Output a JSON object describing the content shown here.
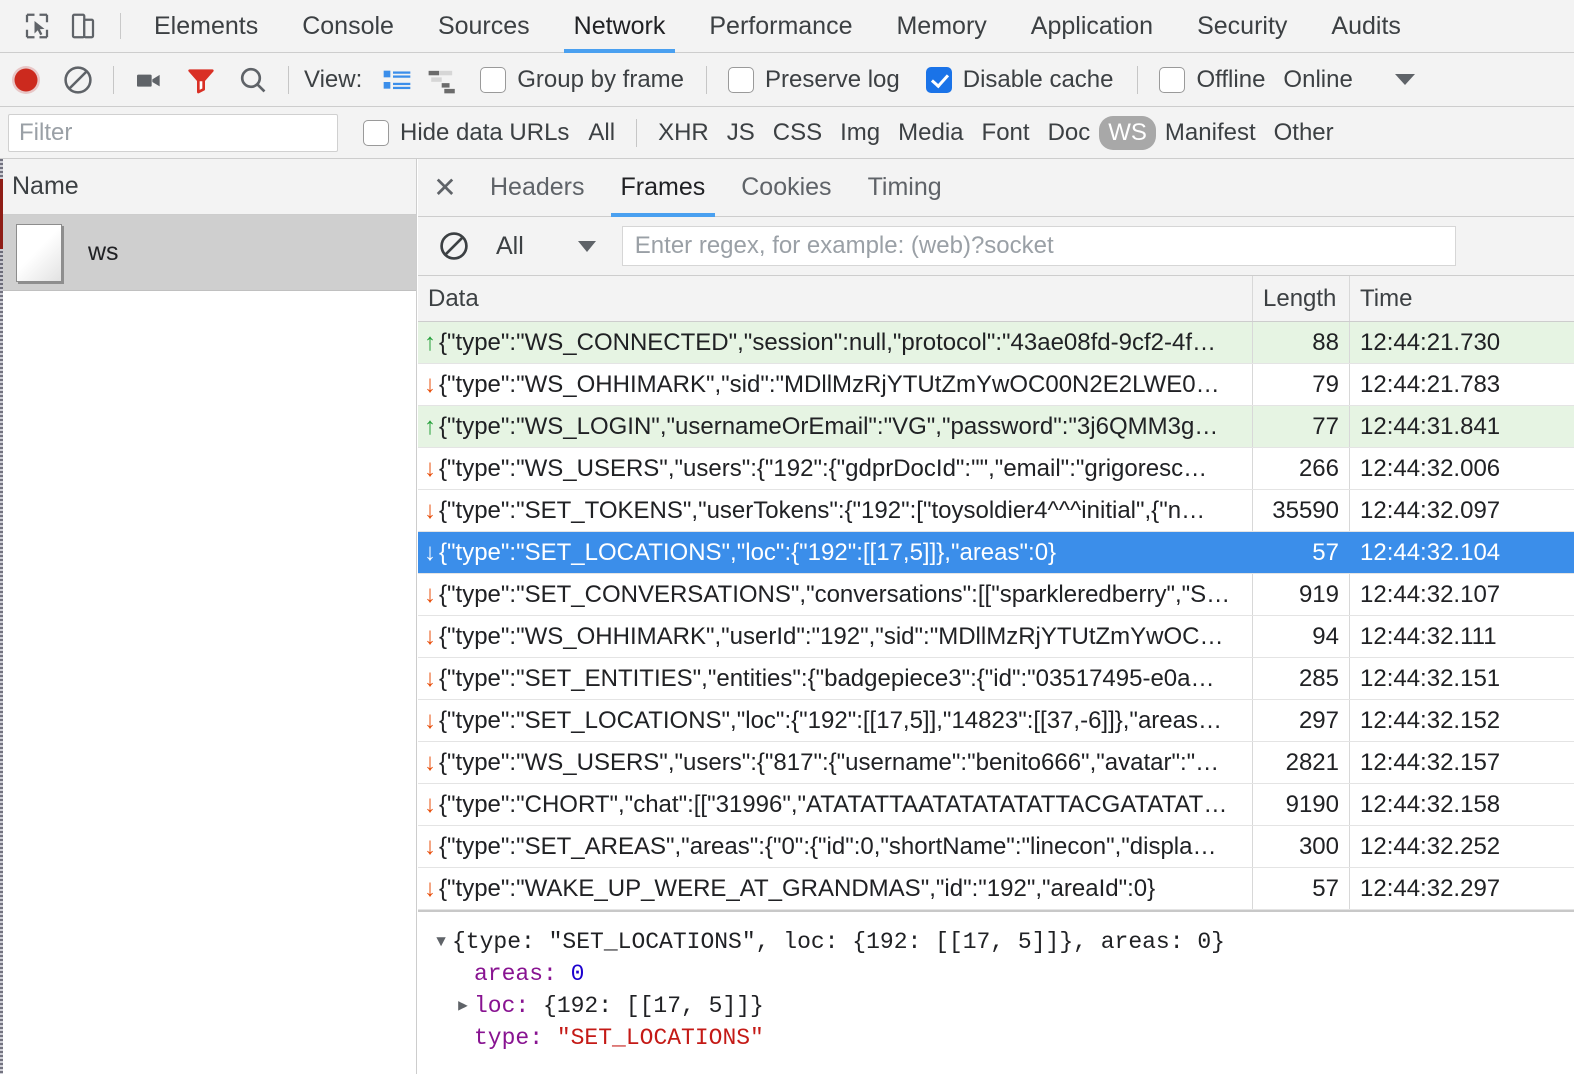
{
  "devtools": {
    "main_tabs": [
      {
        "label": "Elements",
        "active": false
      },
      {
        "label": "Console",
        "active": false
      },
      {
        "label": "Sources",
        "active": false
      },
      {
        "label": "Network",
        "active": true
      },
      {
        "label": "Performance",
        "active": false
      },
      {
        "label": "Memory",
        "active": false
      },
      {
        "label": "Application",
        "active": false
      },
      {
        "label": "Security",
        "active": false
      },
      {
        "label": "Audits",
        "active": false
      }
    ],
    "left_icons": [
      "inspect-element-icon",
      "device-toolbar-icon"
    ]
  },
  "toolbar": {
    "record_label": "record-button",
    "clear_label": "clear-button",
    "camera_label": "capture-screenshots-button",
    "filter_label": "filter-button",
    "search_label": "search-button",
    "view_label": "View:",
    "view_list_icon": "list-view-icon",
    "view_waterfall_icon": "waterfall-view-icon",
    "group_by_frame": {
      "label": "Group by frame",
      "checked": false
    },
    "preserve_log": {
      "label": "Preserve log",
      "checked": false
    },
    "disable_cache": {
      "label": "Disable cache",
      "checked": true
    },
    "offline": {
      "label": "Offline",
      "checked": false
    },
    "throttling": "Online"
  },
  "filterbar": {
    "filter_placeholder": "Filter",
    "filter_value": "",
    "hide_data_urls": {
      "label": "Hide data URLs",
      "checked": false
    },
    "types": [
      {
        "label": "All",
        "selected": false
      },
      {
        "label": "XHR",
        "selected": false
      },
      {
        "label": "JS",
        "selected": false
      },
      {
        "label": "CSS",
        "selected": false
      },
      {
        "label": "Img",
        "selected": false
      },
      {
        "label": "Media",
        "selected": false
      },
      {
        "label": "Font",
        "selected": false
      },
      {
        "label": "Doc",
        "selected": false
      },
      {
        "label": "WS",
        "selected": true
      },
      {
        "label": "Manifest",
        "selected": false
      },
      {
        "label": "Other",
        "selected": false
      }
    ]
  },
  "requests_panel": {
    "column_header": "Name",
    "rows": [
      {
        "name": "ws",
        "selected": true
      }
    ]
  },
  "detail_tabs": [
    {
      "label": "Headers",
      "active": false
    },
    {
      "label": "Frames",
      "active": true
    },
    {
      "label": "Cookies",
      "active": false
    },
    {
      "label": "Timing",
      "active": false
    }
  ],
  "frames_toolbar": {
    "clear_icon": "clear-frames-icon",
    "filter_select": "All",
    "regex_placeholder": "Enter regex, for example: (web)?socket",
    "regex_value": ""
  },
  "frames_table": {
    "columns": [
      "Data",
      "Length",
      "Time"
    ],
    "rows": [
      {
        "dir": "up",
        "data": "{\"type\":\"WS_CONNECTED\",\"session\":null,\"protocol\":\"43ae08fd-9cf2-4f…",
        "length": "88",
        "time": "12:44:21.730",
        "selected": false
      },
      {
        "dir": "down",
        "data": "{\"type\":\"WS_OHHIMARK\",\"sid\":\"MDllMzRjYTUtZmYwOC00N2E2LWE0…",
        "length": "79",
        "time": "12:44:21.783",
        "selected": false
      },
      {
        "dir": "up",
        "data": "{\"type\":\"WS_LOGIN\",\"usernameOrEmail\":\"VG\",\"password\":\"3j6QMM3g…",
        "length": "77",
        "time": "12:44:31.841",
        "selected": false
      },
      {
        "dir": "down",
        "data": "{\"type\":\"WS_USERS\",\"users\":{\"192\":{\"gdprDocId\":\"\",\"email\":\"grigoresc…",
        "length": "266",
        "time": "12:44:32.006",
        "selected": false
      },
      {
        "dir": "down",
        "data": "{\"type\":\"SET_TOKENS\",\"userTokens\":{\"192\":[\"toysoldier4^^^initial\",{\"n…",
        "length": "35590",
        "time": "12:44:32.097",
        "selected": false
      },
      {
        "dir": "down",
        "data": "{\"type\":\"SET_LOCATIONS\",\"loc\":{\"192\":[[17,5]]},\"areas\":0}",
        "length": "57",
        "time": "12:44:32.104",
        "selected": true
      },
      {
        "dir": "down",
        "data": "{\"type\":\"SET_CONVERSATIONS\",\"conversations\":[[\"sparkleredberry\",\"S…",
        "length": "919",
        "time": "12:44:32.107",
        "selected": false
      },
      {
        "dir": "down",
        "data": "{\"type\":\"WS_OHHIMARK\",\"userId\":\"192\",\"sid\":\"MDllMzRjYTUtZmYwOC…",
        "length": "94",
        "time": "12:44:32.111",
        "selected": false
      },
      {
        "dir": "down",
        "data": "{\"type\":\"SET_ENTITIES\",\"entities\":{\"badgepiece3\":{\"id\":\"03517495-e0a…",
        "length": "285",
        "time": "12:44:32.151",
        "selected": false
      },
      {
        "dir": "down",
        "data": "{\"type\":\"SET_LOCATIONS\",\"loc\":{\"192\":[[17,5]],\"14823\":[[37,-6]]},\"areas…",
        "length": "297",
        "time": "12:44:32.152",
        "selected": false
      },
      {
        "dir": "down",
        "data": "{\"type\":\"WS_USERS\",\"users\":{\"817\":{\"username\":\"benito666\",\"avatar\":\"…",
        "length": "2821",
        "time": "12:44:32.157",
        "selected": false
      },
      {
        "dir": "down",
        "data": "{\"type\":\"CHORT\",\"chat\":[[\"31996\",\"ATATATTAATATATATATTACGATATAT…",
        "length": "9190",
        "time": "12:44:32.158",
        "selected": false
      },
      {
        "dir": "down",
        "data": "{\"type\":\"SET_AREAS\",\"areas\":{\"0\":{\"id\":0,\"shortName\":\"linecon\",\"displa…",
        "length": "300",
        "time": "12:44:32.252",
        "selected": false
      },
      {
        "dir": "down",
        "data": "{\"type\":\"WAKE_UP_WERE_AT_GRANDMAS\",\"id\":\"192\",\"areaId\":0}",
        "length": "57",
        "time": "12:44:32.297",
        "selected": false
      }
    ]
  },
  "frame_detail": {
    "summary_prefix": "{type: ",
    "summary_type_str": "\"SET_LOCATIONS\"",
    "summary_mid": ", loc: {192: [[17, 5]]}, areas: 0}",
    "prop_areas": "areas: ",
    "value_areas": "0",
    "prop_loc": "loc: ",
    "value_loc": "{192: [[17, 5]]}",
    "prop_type": "type: ",
    "value_type": "\"SET_LOCATIONS\""
  },
  "colors": {
    "accent_blue": "#4aa0f0",
    "selected_row": "#3b8eea",
    "sent_row": "#e6f4e3",
    "arrow_up": "#25a03a",
    "arrow_down": "#e8500e",
    "checkbox_on": "#1a73e8",
    "json_prop": "#881391",
    "json_num": "#1c00cf",
    "json_str": "#c41a16"
  }
}
